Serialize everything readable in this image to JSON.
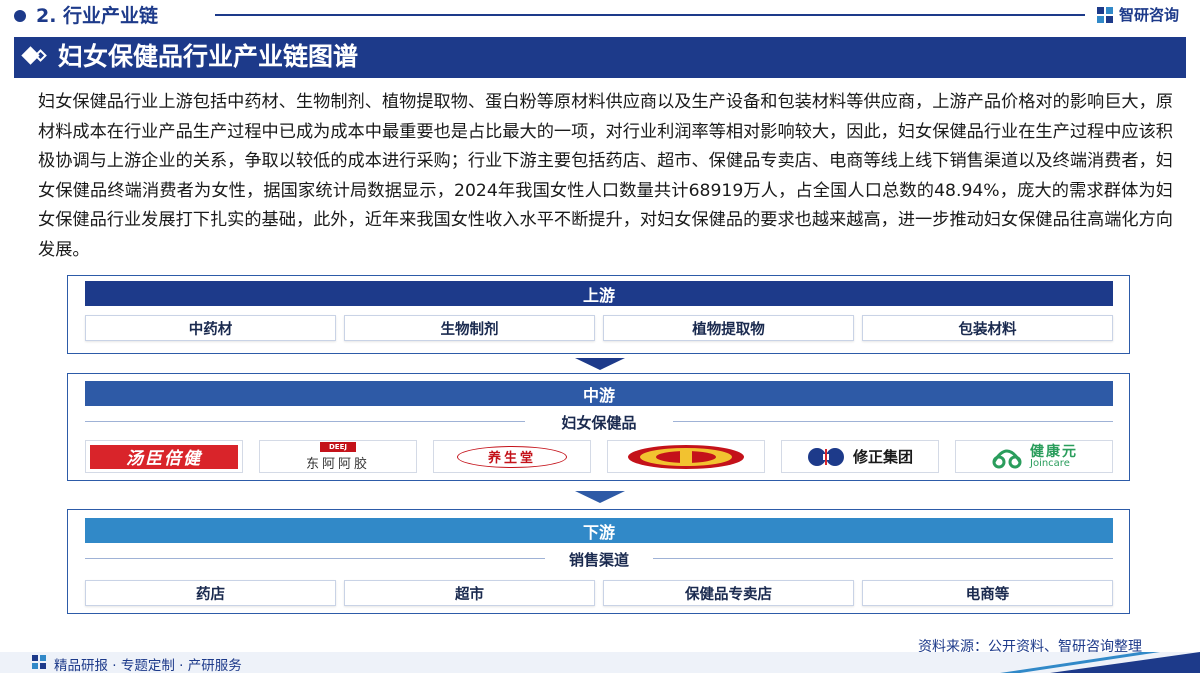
{
  "header": {
    "section_label": "2. 行业产业链",
    "brand_name": "智研咨询"
  },
  "banner": {
    "title": "妇女保健品行业产业链图谱"
  },
  "paragraph": "妇女保健品行业上游包括中药材、生物制剂、植物提取物、蛋白粉等原材料供应商以及生产设备和包装材料等供应商，上游产品价格对的影响巨大，原材料成本在行业产品生产过程中已成为成本中最重要也是占比最大的一项，对行业利润率等相对影响较大，因此，妇女保健品行业在生产过程中应该积极协调与上游企业的关系，争取以较低的成本进行采购；行业下游主要包括药店、超市、保健品专卖店、电商等线上线下销售渠道以及终端消费者，妇女保健品终端消费者为女性，据国家统计局数据显示，2024年我国女性人口数量共计68919万人，占全国人口总数的48.94%，庞大的需求群体为妇女保健品行业发展打下扎实的基础，此外，近年来我国女性收入水平不断提升，对妇女保健品的要求也越来越高，进一步推动妇女保健品往高端化方向发展。",
  "upstream": {
    "title": "上游",
    "items": [
      "中药材",
      "生物制剂",
      "植物提取物",
      "包装材料"
    ]
  },
  "midstream": {
    "title": "中游",
    "subtitle": "妇女保健品",
    "logos": [
      {
        "name": "汤臣倍健",
        "text": "汤臣倍健",
        "color": "#d9242a"
      },
      {
        "name": "东阿阿胶",
        "text": "东阿阿胶",
        "color": "#333333",
        "top_text": "DEEJ"
      },
      {
        "name": "养生堂",
        "text": "养生堂",
        "color": "#c4121a"
      },
      {
        "name": "emblem",
        "text": "",
        "color": "#c4121a"
      },
      {
        "name": "修正集团",
        "text": "修正集团",
        "color": "#1a1a1a"
      },
      {
        "name": "健康元",
        "text": "健康元",
        "sub_text": "Joincare",
        "color": "#2a9d5c"
      }
    ]
  },
  "downstream": {
    "title": "下游",
    "subtitle": "销售渠道",
    "items": [
      "药店",
      "超市",
      "保健品专卖店",
      "电商等"
    ]
  },
  "footer": {
    "source": "资料来源：公开资料、智研咨询整理",
    "services": "精品研报 · 专题定制 · 产研服务"
  },
  "colors": {
    "brand_navy": "#1d3a8a",
    "mid_blue": "#2e5aa6",
    "light_blue": "#3189c8"
  }
}
